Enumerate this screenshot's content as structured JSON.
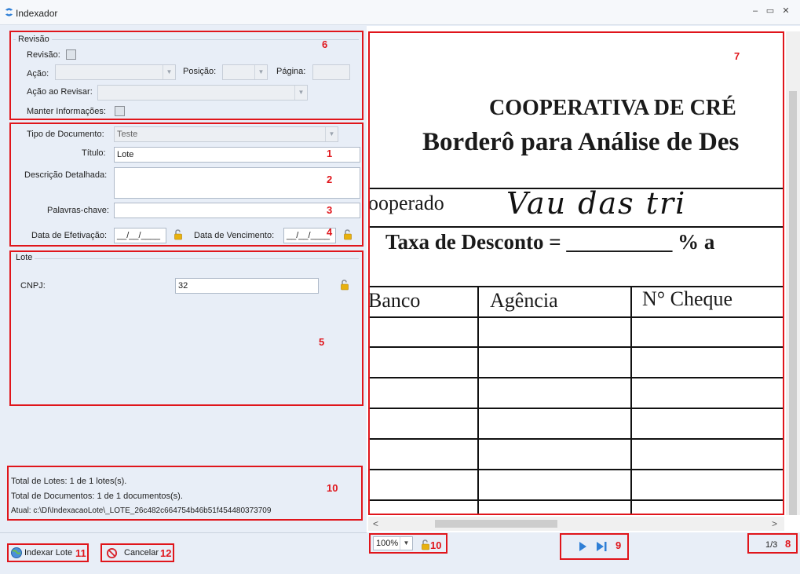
{
  "window": {
    "title": "Indexador",
    "minimize": "‒",
    "maximize": "▭",
    "close": "✕"
  },
  "revisao": {
    "legend": "Revisão",
    "revisao_label": "Revisão:",
    "acao_label": "Ação:",
    "posicao_label": "Posição:",
    "pagina_label": "Página:",
    "acao_revisar_label": "Ação ao Revisar:",
    "manter_label": "Manter Informações:",
    "marker": "6"
  },
  "documento": {
    "tipo_label": "Tipo de Documento:",
    "tipo_value": "Teste",
    "titulo_label": "Título:",
    "titulo_value": "Lote",
    "descricao_label": "Descrição Detalhada:",
    "descricao_value": "",
    "palavras_label": "Palavras-chave:",
    "palavras_value": "",
    "efetivacao_label": "Data de Efetivação:",
    "efetivacao_value": "__/__/____",
    "vencimento_label": "Data de Vencimento:",
    "vencimento_value": "__/__/____",
    "markers": {
      "titulo": "1",
      "descricao": "2",
      "palavras": "3",
      "datas": "4"
    }
  },
  "lote": {
    "legend": "Lote",
    "cnpj_label": "CNPJ:",
    "cnpj_value": "32",
    "marker": "5"
  },
  "totais": {
    "lotes": "Total de Lotes:  1 de 1 lotes(s).",
    "documentos": "Total de Documentos: 1 de 1 documentos(s).",
    "atual": "Atual: c:\\DI\\IndexacaoLote\\_LOTE_26c482c664754b46b51f454480373709",
    "marker": "10"
  },
  "buttons": {
    "indexar": "Indexar Lote",
    "indexar_marker": "11",
    "cancelar": "Cancelar",
    "cancelar_marker": "12"
  },
  "viewer": {
    "marker": "7",
    "doc_heading1": "COOPERATIVA DE CRÉ",
    "doc_heading2": "Borderô para Análise de Des",
    "doc_cooperado": "ooperado",
    "doc_handwriting": "Vau  das  tri",
    "doc_taxa": "Taxa de Desconto = __________ % a",
    "doc_col1": "Banco",
    "doc_col2": "Agência",
    "doc_col3": "N° Cheque",
    "scroll_left": "<",
    "scroll_right": ">"
  },
  "status": {
    "zoom_value": "100%",
    "zoom_marker": "10",
    "nav_marker": "9",
    "page_value": "1/3",
    "page_marker": "8"
  },
  "colors": {
    "accent_red": "#e0151b",
    "panel_bg": "#e8eef7",
    "nav_blue": "#2f7fd6"
  }
}
